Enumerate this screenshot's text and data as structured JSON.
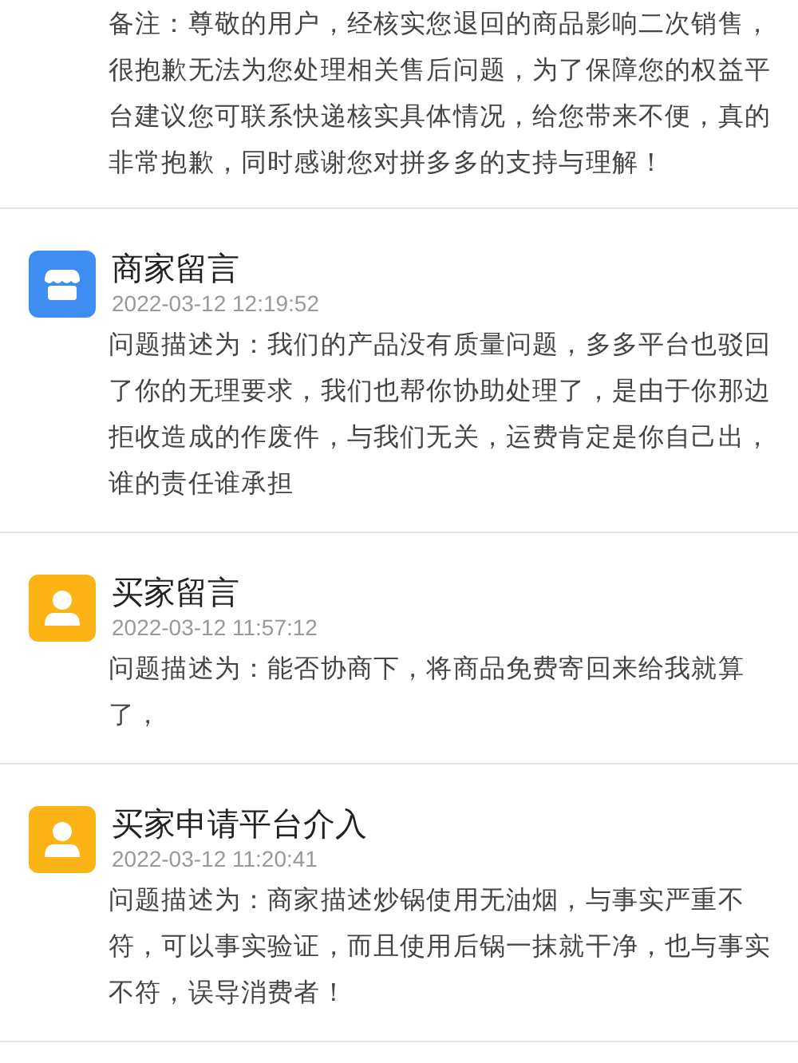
{
  "notes": [
    {
      "kind": "note",
      "body": "备注：尊敬的用户，经核实您退回的商品影响二次销售，很抱歉无法为您处理相关售后问题，为了保障您的权益平台建议您可联系快递核实具体情况，给您带来不便，真的非常抱歉，同时感谢您对拼多多的支持与理解！"
    },
    {
      "kind": "shop",
      "title": "商家留言",
      "time": "2022-03-12 12:19:52",
      "body": "问题描述为：我们的产品没有质量问题，多多平台也驳回了你的无理要求，我们也帮你协助处理了，是由于你那边拒收造成的作废件，与我们无关，运费肯定是你自己出，谁的责任谁承担"
    },
    {
      "kind": "user",
      "title": "买家留言",
      "time": "2022-03-12 11:57:12",
      "body": "问题描述为：能否协商下，将商品免费寄回来给我就算了，"
    },
    {
      "kind": "user",
      "title": "买家申请平台介入",
      "time": "2022-03-12 11:20:41",
      "body": "问题描述为：商家描述炒锅使用无油烟，与事实严重不符，可以事实验证，而且使用后锅一抹就干净，也与事实不符，误导消费者！"
    }
  ]
}
